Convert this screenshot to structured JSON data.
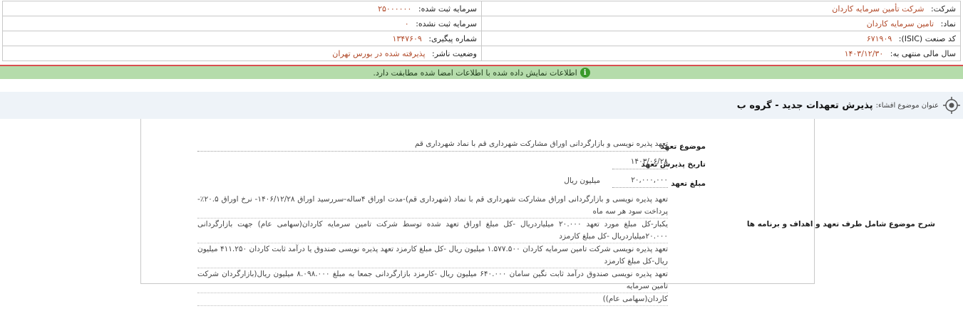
{
  "company_info": {
    "company_label": "شرکت:",
    "company_value": "شرکت تأمین سرمایه کاردان",
    "reg_capital_label": "سرمایه ثبت شده:",
    "reg_capital_value": "۲۵۰۰۰۰۰۰",
    "symbol_label": "نماد:",
    "symbol_value": "تامین سرمایه کاردان",
    "unreg_capital_label": "سرمایه ثبت نشده:",
    "unreg_capital_value": "۰",
    "isic_label": "کد صنعت (ISIC):",
    "isic_value": "۶۷۱۹۰۹",
    "tracking_label": "شماره پیگیری:",
    "tracking_value": "۱۳۴۷۶۰۹",
    "fiscal_label": "سال مالی منتهی به:",
    "fiscal_value": "۱۴۰۳/۱۲/۳۰",
    "publisher_label": "وضعیت ناشر:",
    "publisher_value": "پذیرفته شده در بورس تهران"
  },
  "status": {
    "icon": "info-icon",
    "text": "اطلاعات نمایش داده شده با اطلاعات امضا شده مطابقت دارد."
  },
  "subject": {
    "label": "عنوان موضوع افشاء:",
    "title": "پذیرش تعهدات جدید - گروه ب"
  },
  "details": {
    "subject_label": "موضوع تعهد",
    "subject_value": "تعهد پذیره نویسی و بازارگردانی اوراق مشارکت شهرداری قم با نماد شهرداری قم",
    "date_label": "تاریخ پذیرش تعهد",
    "date_value": "۱۴۰۳/۰۶/۲۸",
    "amount_label": "مبلغ تعهد",
    "amount_value": "۲۰,۰۰۰,۰۰۰",
    "amount_unit": "میلیون ریال",
    "desc_label": "شرح موضوع شامل طرف تعهد و اهداف و برنامه ها",
    "desc_lines": [
      "تعهد پذیره نویسی و بازارگردانی اوراق مشارکت شهرداری قم با نماد (شهرداری قم)-مدت اوراق ۴ساله-سررسید اوراق ۱۴۰۶/۱۲/۲۸- نرخ اوراق ۲۰.۵٪- پرداخت سود هر سه ماه",
      "یکبار-کل مبلغ مورد تعهد ۲۰.۰۰۰ میلیاردریال -کل مبلغ اوراق تعهد شده توسط شرکت تامین سرمایه کاردان(سهامی عام) جهت بازارگردانی ۲۰.۰۰۰میلیاردریال -کل مبلغ کارمزد",
      "تعهد پذیره نویسی شرکت تامین سرمایه کاردان ۱.۵۷۷.۵۰۰ میلیون ریال -کل مبلغ کارمزد تعهد پذیره نویسی صندوق یا درآمد ثابت کاردان ۴۱۱.۲۵۰ میلیون ریال-کل مبلغ کارمزد",
      "تعهد پذیره نویسی صندوق درآمد ثابت نگین سامان ۶۴۰.۰۰۰ میلیون ریال -کارمزد بازارگردانی جمعا به مبلغ ۸.۰۹۸.۰۰۰ میلیون ریال(بازارگردان شرکت تامین سرمایه",
      "کاردان(سهامی عام))"
    ]
  },
  "colors": {
    "value_text": "#b14a2a",
    "status_bg": "#b5dcab",
    "status_border": "#d95050",
    "subject_bg": "#eef3f8"
  }
}
